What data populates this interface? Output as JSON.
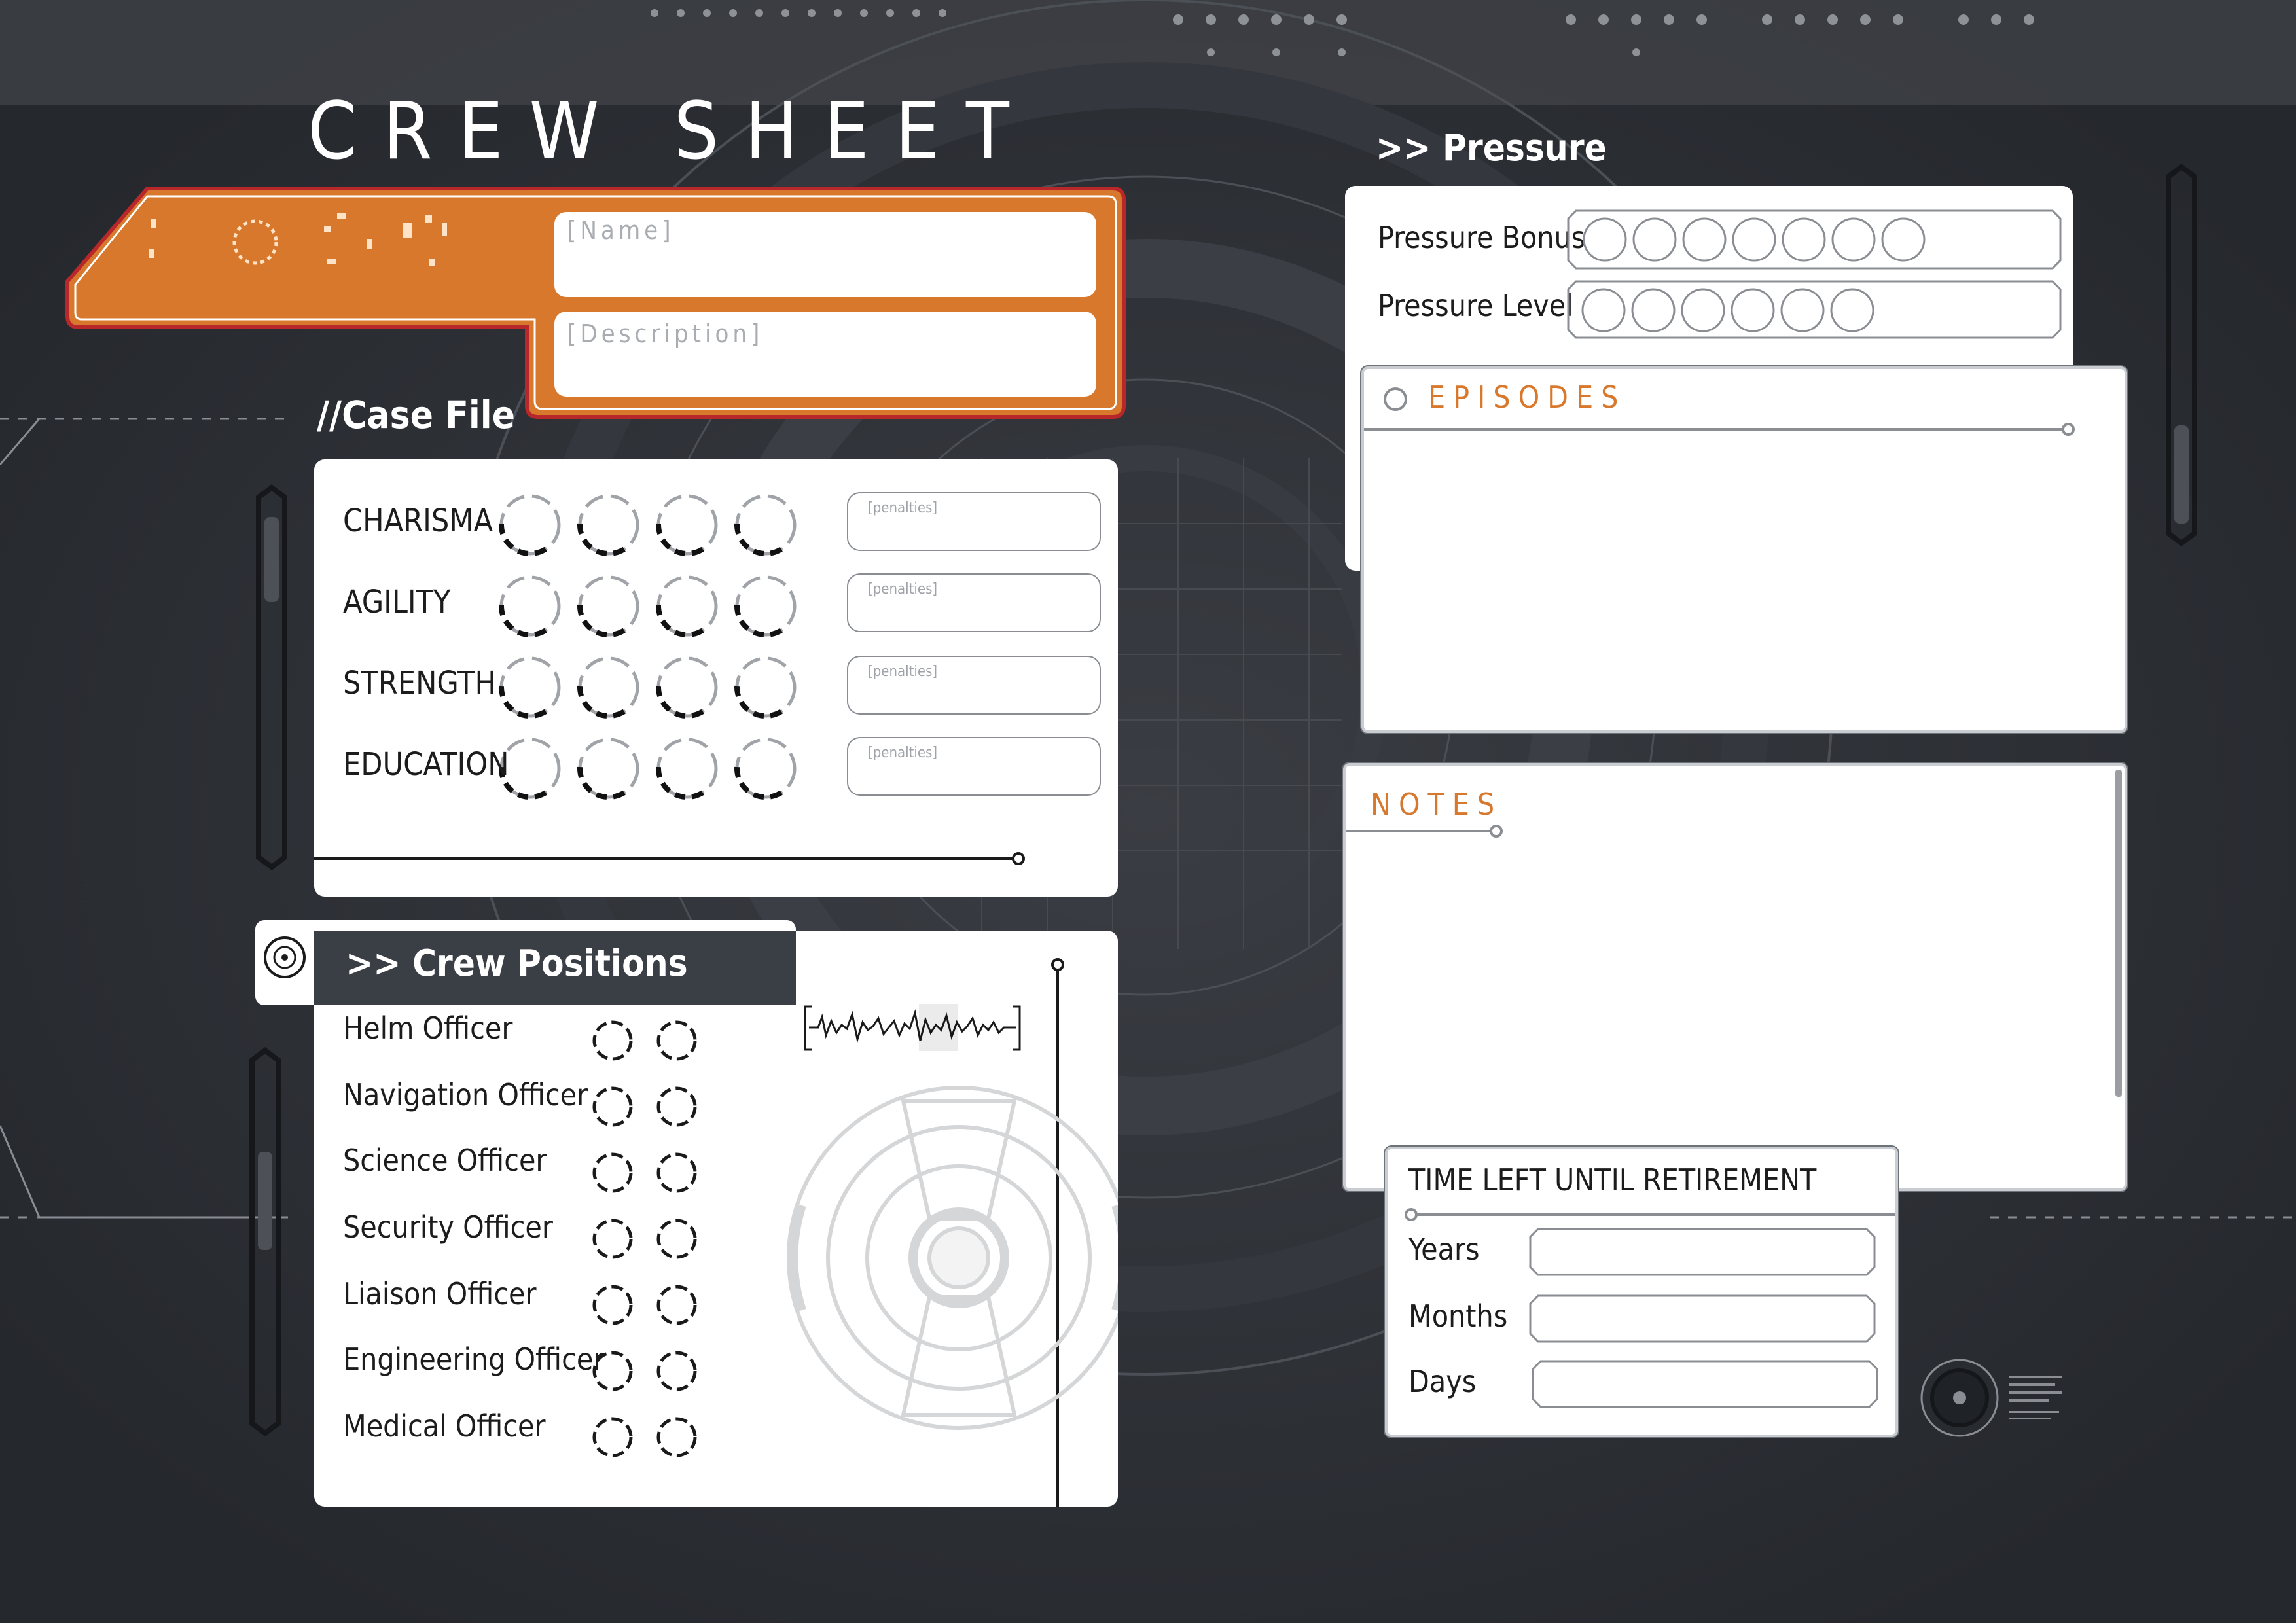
{
  "header": {
    "title": "CREW SHEET",
    "name_placeholder": "[Name]",
    "description_placeholder": "[Description]"
  },
  "case_file": {
    "heading": "//Case File",
    "attributes": [
      {
        "label": "CHARISMA",
        "penalty_placeholder": "[penalties]"
      },
      {
        "label": "AGILITY",
        "penalty_placeholder": "[penalties]"
      },
      {
        "label": "STRENGTH",
        "penalty_placeholder": "[penalties]"
      },
      {
        "label": "EDUCATION",
        "penalty_placeholder": "[penalties]"
      }
    ]
  },
  "crew_positions": {
    "heading": ">> Crew Positions",
    "positions": [
      "Helm Officer",
      "Navigation Officer",
      "Science Officer",
      "Security Officer",
      "Liaison Officer",
      "Engineering Officer",
      "Medical Officer"
    ]
  },
  "pressure": {
    "heading": ">> Pressure",
    "bonus_label": "Pressure Bonus",
    "bonus_boxes": 7,
    "level_label": "Pressure Level",
    "level_boxes": 6
  },
  "episodes": {
    "heading": "EPISODES"
  },
  "notes": {
    "heading": "NOTES"
  },
  "retirement": {
    "heading": "TIME LEFT UNTIL RETIREMENT",
    "years_label": "Years",
    "months_label": "Months",
    "days_label": "Days"
  },
  "colors": {
    "background": "#2d3036",
    "accent_orange": "#d8782c",
    "accent_red": "#b8282a",
    "panel": "#ffffff",
    "dark_tab": "#3a3e45"
  },
  "icons": [
    "target-icon",
    "waveform-icon",
    "hud-dial-icon",
    "hud-ring-icon"
  ]
}
